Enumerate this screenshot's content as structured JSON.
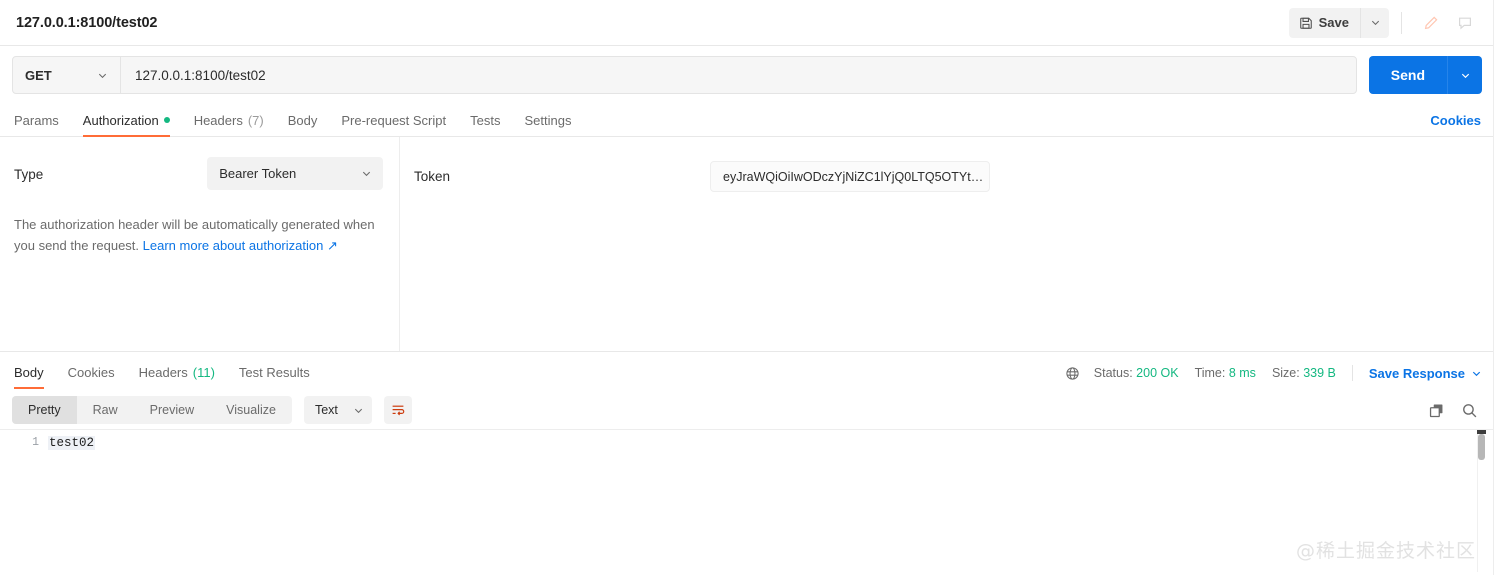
{
  "request": {
    "title": "127.0.0.1:8100/test02",
    "method": "GET",
    "url": "127.0.0.1:8100/test02",
    "send_label": "Send"
  },
  "toolbar": {
    "save_label": "Save",
    "save_icon": "floppy-disk-icon",
    "save_caret_icon": "chevron-down-icon",
    "edit_icon": "pencil-icon",
    "comment_icon": "comment-icon"
  },
  "request_tabs": [
    {
      "label": "Params",
      "count": "",
      "active": false,
      "dot": false
    },
    {
      "label": "Authorization",
      "count": "",
      "active": true,
      "dot": true
    },
    {
      "label": "Headers",
      "count": "(7)",
      "active": false,
      "dot": false
    },
    {
      "label": "Body",
      "count": "",
      "active": false,
      "dot": false
    },
    {
      "label": "Pre-request Script",
      "count": "",
      "active": false,
      "dot": false
    },
    {
      "label": "Tests",
      "count": "",
      "active": false,
      "dot": false
    },
    {
      "label": "Settings",
      "count": "",
      "active": false,
      "dot": false
    }
  ],
  "cookies_link": "Cookies",
  "authorization": {
    "type_label": "Type",
    "type_value": "Bearer Token",
    "help_text": "The authorization header will be automatically generated when you send the request. ",
    "help_link": "Learn more about authorization",
    "help_link_icon": "external-link-icon",
    "token_label": "Token",
    "token_value": "eyJraWQiOiIwODczYjNiZC1lYjQ0LTQ5OTYt…",
    "token_placeholder": "Token"
  },
  "response_tabs": [
    {
      "label": "Body",
      "count": "",
      "active": true
    },
    {
      "label": "Cookies",
      "count": "",
      "active": false
    },
    {
      "label": "Headers",
      "count": "(11)",
      "active": false
    },
    {
      "label": "Test Results",
      "count": "",
      "active": false
    }
  ],
  "response_meta": {
    "globe_icon": "globe-icon",
    "status_key": "Status:",
    "status_value": "200 OK",
    "time_key": "Time:",
    "time_value": "8 ms",
    "size_key": "Size:",
    "size_value": "339 B",
    "save_response_label": "Save Response",
    "save_response_caret": "chevron-down-icon"
  },
  "response_toolbar": {
    "views": [
      {
        "label": "Pretty",
        "active": true
      },
      {
        "label": "Raw",
        "active": false
      },
      {
        "label": "Preview",
        "active": false
      },
      {
        "label": "Visualize",
        "active": false
      }
    ],
    "format_value": "Text",
    "wrap_icon": "wrap-text-icon",
    "copy_icon": "copy-icon",
    "search_icon": "search-icon"
  },
  "response_body": {
    "lines": [
      {
        "number": "1",
        "text": "test02"
      }
    ]
  },
  "watermark": "@稀土掘金技术社区",
  "colors": {
    "accent_orange": "#ff6c37",
    "link_blue": "#0b74e5",
    "success_green": "#14b881"
  }
}
